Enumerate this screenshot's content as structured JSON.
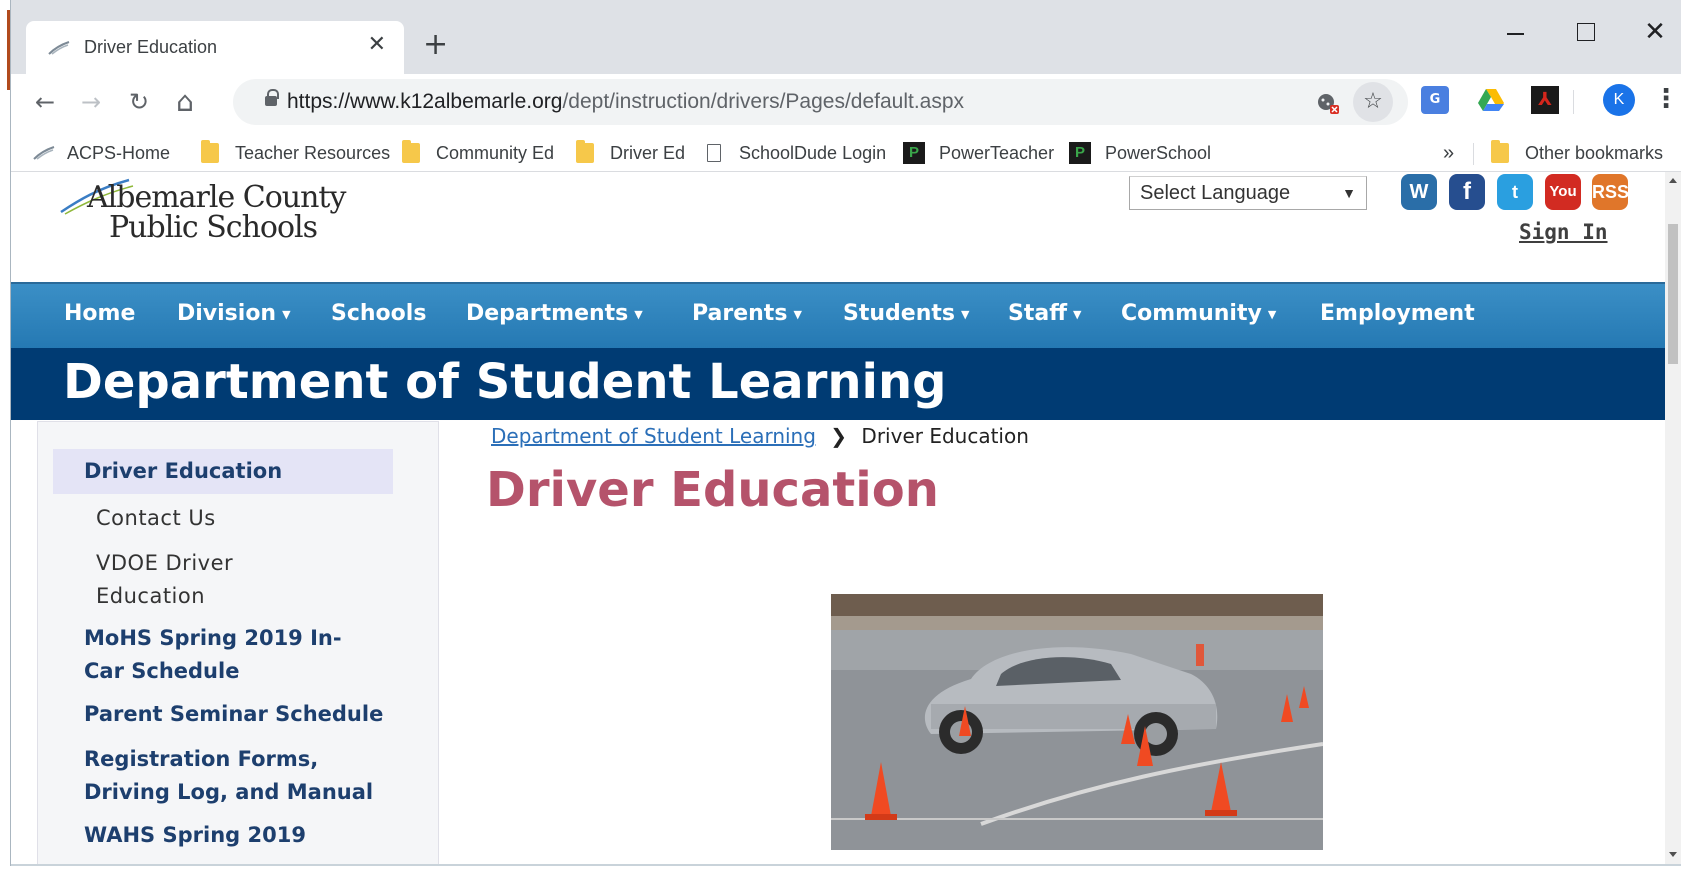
{
  "browser": {
    "tab": {
      "title": "Driver Education",
      "close": "✕"
    },
    "new_tab": "+",
    "window_controls": {
      "minimize": "minimize",
      "maximize": "maximize",
      "close": "✕"
    },
    "toolbar": {
      "back": "←",
      "forward": "→",
      "reload": "↻",
      "home": "⌂",
      "url_host": "https://www.k12albemarle.org",
      "url_path": "/dept/instruction/drivers/Pages/default.aspx",
      "star": "☆",
      "profile_initial": "K",
      "menu": "⋮"
    },
    "bookmarks": {
      "items": [
        "ACPS-Home",
        "Teacher Resources",
        "Community Ed",
        "Driver Ed",
        "SchoolDude Login",
        "PowerTeacher",
        "PowerSchool"
      ],
      "overflow": "»",
      "other": "Other bookmarks"
    }
  },
  "site": {
    "logo": {
      "line1": "Albemarle County",
      "line2": "Public Schools"
    },
    "language_select": {
      "value": "Select Language",
      "caret": "▼"
    },
    "social": {
      "wordpress": "W",
      "facebook": "f",
      "twitter": "t",
      "youtube": "You",
      "rss": "RSS"
    },
    "sign_in": "Sign In",
    "nav": [
      {
        "label": "Home",
        "has_caret": false
      },
      {
        "label": "Division",
        "has_caret": true
      },
      {
        "label": "Schools",
        "has_caret": false
      },
      {
        "label": "Departments",
        "has_caret": true
      },
      {
        "label": "Parents",
        "has_caret": true
      },
      {
        "label": "Students",
        "has_caret": true
      },
      {
        "label": "Staff",
        "has_caret": true
      },
      {
        "label": "Community",
        "has_caret": true
      },
      {
        "label": "Employment",
        "has_caret": false
      }
    ],
    "nav_caret": "▼",
    "banner_title": "Department of Student Learning"
  },
  "sidebar": {
    "active": "Driver Education",
    "sub_items": [
      "Contact Us",
      "VDOE Driver",
      "Education"
    ],
    "items": [
      "MoHS Spring 2019 In-",
      "Car Schedule",
      "Parent Seminar Schedule",
      "Registration Forms,",
      "Driving Log, and Manual",
      "WAHS Spring 2019"
    ]
  },
  "main": {
    "breadcrumb": {
      "parent": "Department of Student Learning",
      "separator": "❯",
      "current": "Driver Education"
    },
    "title": "Driver Education"
  },
  "colors": {
    "nav_blue": "#2a82bd",
    "banner_navy": "#003b73",
    "title_rose": "#b5536b",
    "sidebar_link": "#1d3f6e"
  }
}
